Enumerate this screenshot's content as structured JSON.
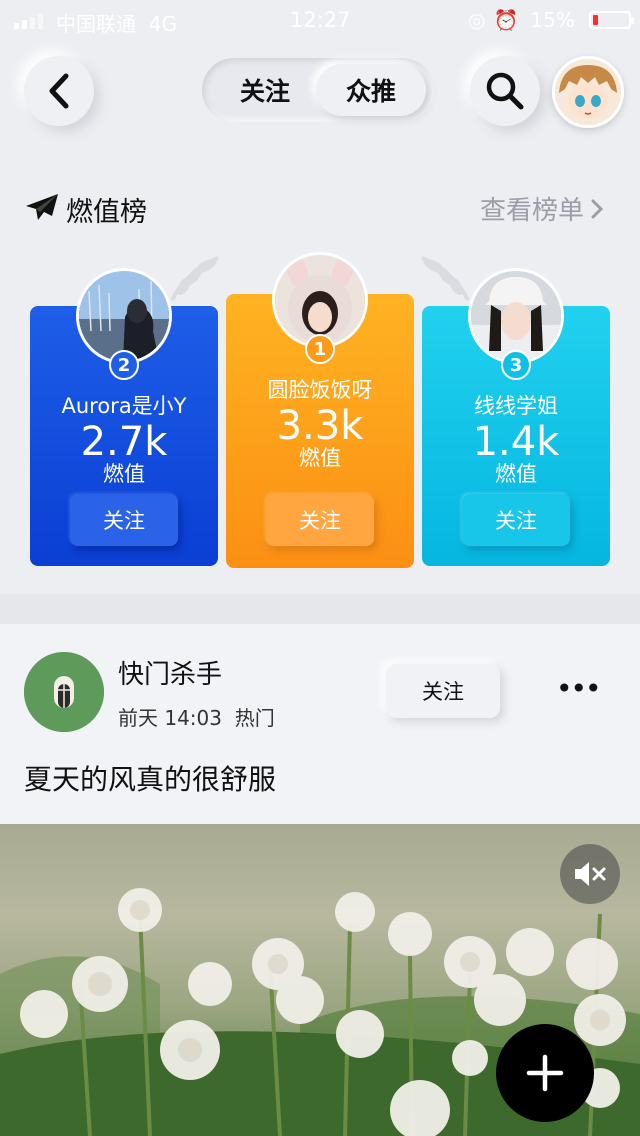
{
  "status_bar": {
    "carrier": "中国联通",
    "network": "4G",
    "time": "12:27",
    "battery_pct": "15%",
    "battery_level": 0.15
  },
  "header": {
    "tabs": [
      {
        "label": "关注",
        "active": false
      },
      {
        "label": "众推",
        "active": true
      }
    ],
    "icons": [
      "back-icon",
      "search-icon",
      "avatar"
    ]
  },
  "ranking": {
    "title": "燃值榜",
    "more_label": "查看榜单",
    "cards": [
      {
        "rank": "2",
        "name": "Aurora是小Y",
        "value": "2.7k",
        "unit": "燃值",
        "follow": "关注",
        "color": "#0f46d8"
      },
      {
        "rank": "1",
        "name": "圆脸饭饭呀",
        "value": "3.3k",
        "unit": "燃值",
        "follow": "关注",
        "color": "#fd9a1a"
      },
      {
        "rank": "3",
        "name": "线线学姐",
        "value": "1.4k",
        "unit": "燃值",
        "follow": "关注",
        "color": "#0ec0e6"
      }
    ]
  },
  "post": {
    "author": "快门杀手",
    "time": "前天 14:03",
    "tag": "热门",
    "follow_label": "关注",
    "more_label": "•••",
    "text": "夏天的风真的很舒服"
  },
  "media": {
    "mute_icon": "mute-icon",
    "fab_icon": "plus-icon"
  }
}
